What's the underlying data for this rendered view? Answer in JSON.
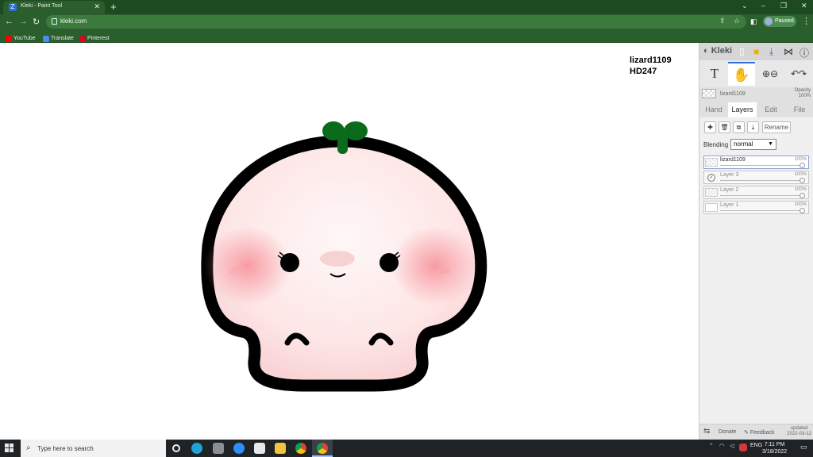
{
  "browser": {
    "tab_title": "Kleki - Paint Tool",
    "tab_favicon_letter": "Z",
    "new_tab_symbol": "+",
    "url": "kleki.com",
    "profile_label": "Paused",
    "bookmarks": [
      {
        "label": "YouTube",
        "icon": "youtube-icon",
        "color": "#ff0000"
      },
      {
        "label": "Translate",
        "icon": "translate-icon",
        "color": "#4a8af4"
      },
      {
        "label": "Pinterest",
        "icon": "pinterest-icon",
        "color": "#e60023"
      }
    ],
    "window_controls": [
      "⌄",
      "–",
      "❐",
      "✕"
    ]
  },
  "canvas": {
    "signature_line1": "lizard1109",
    "signature_line2": "HD247"
  },
  "panel": {
    "logo": "Kleki",
    "current_layer_name": "lizard1109",
    "opacity_label": "Opacity",
    "opacity_value": "100%",
    "tabs": [
      "Hand",
      "Layers",
      "Edit",
      "File"
    ],
    "active_tab": "Layers",
    "rename_label": "Rename",
    "blending_label": "Blending",
    "blending_value": "normal",
    "layers": [
      {
        "name": "lizard1109",
        "opacity": "100%",
        "selected": true
      },
      {
        "name": "Layer 3",
        "opacity": "100%",
        "selected": false
      },
      {
        "name": "Layer 2",
        "opacity": "100%",
        "selected": false
      },
      {
        "name": "Layer 1",
        "opacity": "100%",
        "selected": false
      }
    ],
    "footer": {
      "donate": "Donate",
      "feedback": "Feedback",
      "updated_label": "updated",
      "updated_date": "2022-03-12"
    }
  },
  "taskbar": {
    "search_placeholder": "Type here to search",
    "language": "ENG",
    "time": "7:11 PM",
    "date": "3/18/2022"
  },
  "colors": {
    "browser_frame": "#1d4a20",
    "toolbar": "#2a5e2c",
    "mushroom_outline": "#000000",
    "mushroom_fill": "#fde8e8",
    "blush": "#f7a1a6",
    "sprout": "#0b6b1c",
    "accent": "#2f6fd6"
  }
}
